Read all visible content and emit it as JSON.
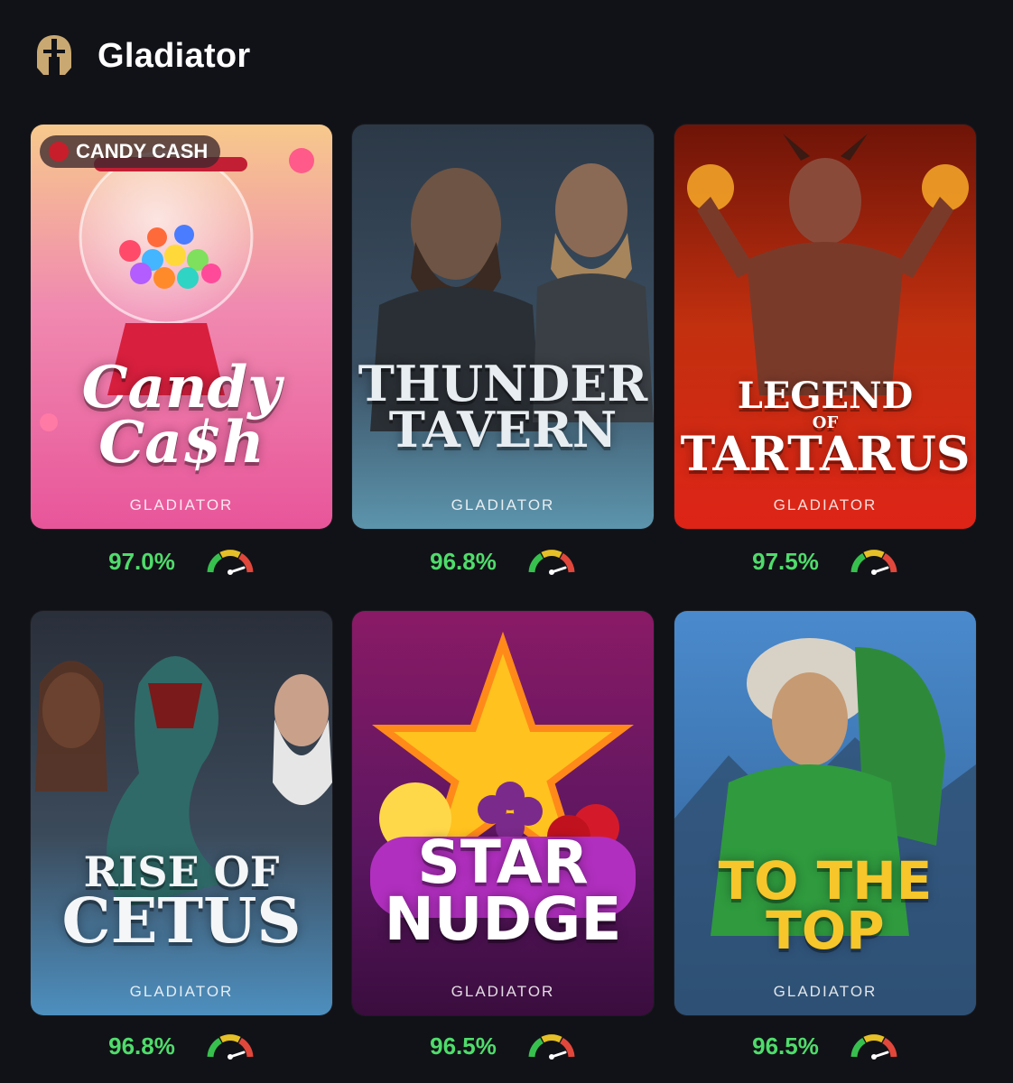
{
  "header": {
    "title": "Gladiator",
    "icon": "gladiator-helmet-icon"
  },
  "games": [
    {
      "title_lines": [
        "Candy",
        "Ca$h"
      ],
      "studio": "GLADIATOR",
      "rtp": "97.0%",
      "badge": "CANDY CASH"
    },
    {
      "title_lines": [
        "THUNDER",
        "TAVERN"
      ],
      "studio": "GLADIATOR",
      "rtp": "96.8%"
    },
    {
      "title_lines": [
        "LEGEND",
        "OF",
        "TARTARUS"
      ],
      "studio": "GLADIATOR",
      "rtp": "97.5%"
    },
    {
      "title_lines": [
        "RISE OF",
        "CETUS"
      ],
      "studio": "GLADIATOR",
      "rtp": "96.8%"
    },
    {
      "title_lines": [
        "STAR",
        "NUDGE"
      ],
      "studio": "GLADIATOR",
      "rtp": "96.5%"
    },
    {
      "title_lines": [
        "TO THE",
        "TOP"
      ],
      "studio": "GLADIATOR",
      "rtp": "96.5%"
    }
  ],
  "colors": {
    "background": "#111217",
    "rtp_text": "#4fdc6b",
    "accent_gold": "#c9a872"
  }
}
